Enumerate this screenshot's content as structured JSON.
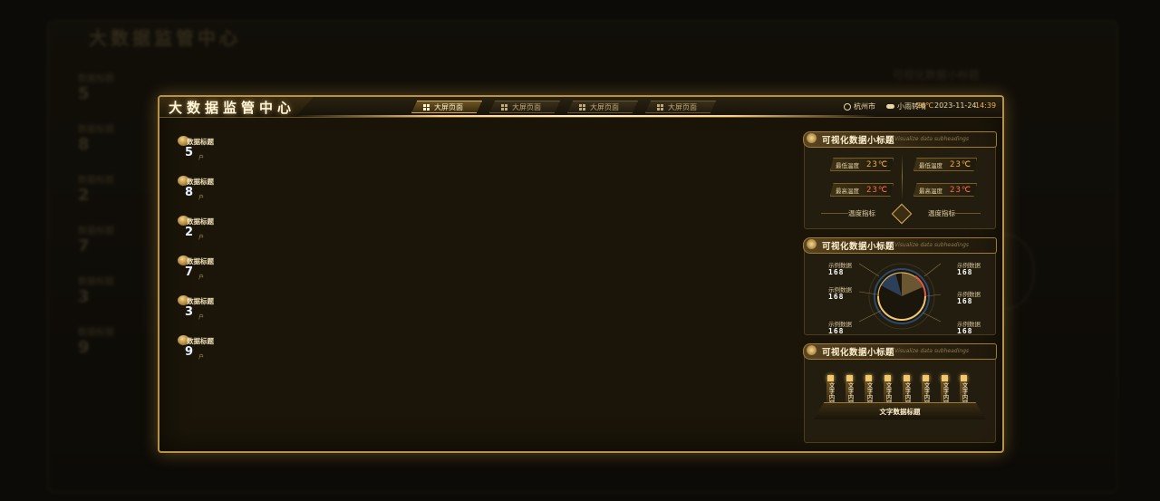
{
  "app": {
    "title": "大数据监管中心"
  },
  "nav": {
    "tabs": [
      {
        "label": "大屏页面",
        "active": true
      },
      {
        "label": "大屏页面",
        "active": false
      },
      {
        "label": "大屏页面",
        "active": false
      },
      {
        "label": "大屏页面",
        "active": false
      }
    ]
  },
  "status": {
    "city": "杭州市",
    "weather": "小雨转晴",
    "temp": "26℃",
    "date": "2023-11-24",
    "time": "14:39"
  },
  "stats": [
    {
      "label": "数据标题",
      "value": "5",
      "unit": "户"
    },
    {
      "label": "数据标题",
      "value": "8",
      "unit": "户"
    },
    {
      "label": "数据标题",
      "value": "2",
      "unit": "户"
    },
    {
      "label": "数据标题",
      "value": "7",
      "unit": "户"
    },
    {
      "label": "数据标题",
      "value": "3",
      "unit": "户"
    },
    {
      "label": "数据标题",
      "value": "9",
      "unit": "户"
    }
  ],
  "panels": {
    "temperature": {
      "title": "可视化数据小标题",
      "subtitle": "Visualize data subheadings",
      "chips": [
        {
          "label": "最低温度",
          "value": "23℃",
          "level": "low"
        },
        {
          "label": "最低温度",
          "value": "23℃",
          "level": "low"
        },
        {
          "label": "最高温度",
          "value": "23℃",
          "level": "high"
        },
        {
          "label": "最高温度",
          "value": "23℃",
          "level": "high"
        }
      ],
      "metric_left": "温度指标",
      "metric_right": "温度指标"
    },
    "ring": {
      "title": "可视化数据小标题",
      "subtitle": "Visualize data subheadings",
      "items": [
        {
          "label": "示例数据",
          "value": "168"
        },
        {
          "label": "示例数据",
          "value": "168"
        },
        {
          "label": "示例数据",
          "value": "168"
        },
        {
          "label": "示例数据",
          "value": "168"
        },
        {
          "label": "示例数据",
          "value": "168"
        },
        {
          "label": "示例数据",
          "value": "168"
        }
      ]
    },
    "bars": {
      "title": "可视化数据小标题",
      "subtitle": "Visualize data subheadings",
      "columns": [
        "文字内容",
        "文字内容",
        "文字内容",
        "文字内容",
        "文字内容",
        "文字内容",
        "文字内容",
        "文字内容"
      ],
      "footer": "文字数据标题"
    }
  },
  "colors": {
    "accent": "#d8ac55",
    "warm": "#f0b04a",
    "hot": "#ff6a4e",
    "ring_blue": "#5c9be8"
  }
}
